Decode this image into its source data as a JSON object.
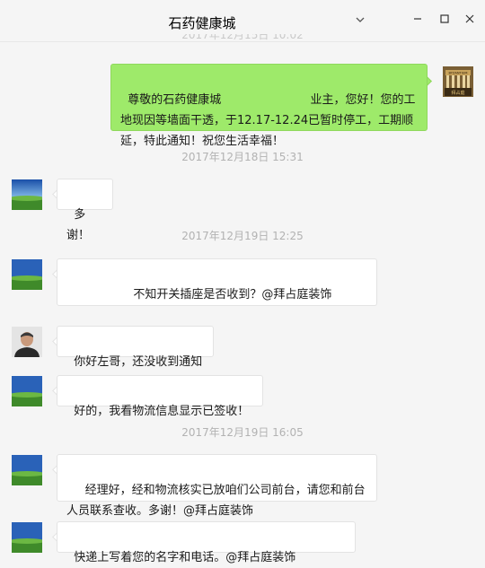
{
  "window": {
    "title": "石药健康城",
    "faded_timestamp": "2017年12月15日 10:02"
  },
  "messages": [
    {
      "id": "m1",
      "sender": "self",
      "text": "尊敬的石药健康城                        业主，您好！您的工地现因等墙面干透，于12.17-12.24已暂时停工，工期顺延，特此通知！祝您生活幸福！"
    },
    {
      "id": "m2",
      "sender": "client",
      "text": "多谢！"
    },
    {
      "id": "m3",
      "sender": "client",
      "text": "                不知开关插座是否收到？@拜占庭装饰"
    },
    {
      "id": "m4",
      "sender": "other",
      "text": "你好左哥，还没收到通知"
    },
    {
      "id": "m5",
      "sender": "client",
      "text": "好的，我看物流信息显示已签收！"
    },
    {
      "id": "m6",
      "sender": "client",
      "text": "   经理好，经和物流核实已放咱们公司前台，请您和前台人员联系查收。多谢！@拜占庭装饰"
    },
    {
      "id": "m7",
      "sender": "client",
      "text": "快递上写着您的名字和电话。@拜占庭装饰"
    }
  ],
  "timestamps": [
    "2017年12月18日 15:31",
    "2017年12月19日 12:25",
    "2017年12月19日 16:05"
  ],
  "self_avatar": {
    "text_top": "BYZANTIUM",
    "text_bottom": "拜占庭"
  },
  "colors": {
    "self_bubble": "#9eea6a",
    "other_bubble": "#ffffff",
    "background": "#f5f5f5",
    "timestamp": "#b2b2b2"
  }
}
